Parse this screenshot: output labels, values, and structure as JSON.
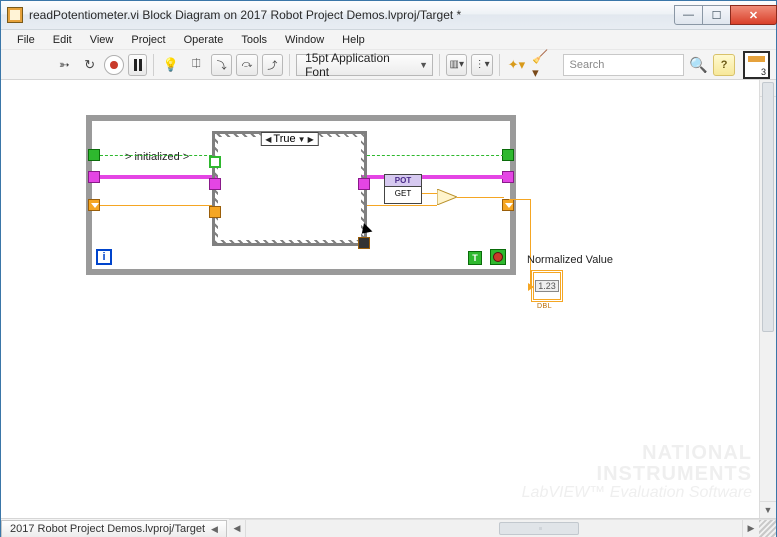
{
  "window": {
    "title": "readPotentiometer.vi Block Diagram on 2017 Robot Project Demos.lvproj/Target *"
  },
  "menu": {
    "file": "File",
    "edit": "Edit",
    "view": "View",
    "project": "Project",
    "operate": "Operate",
    "tools": "Tools",
    "window": "Window",
    "help": "Help"
  },
  "toolbar": {
    "font_label": "15pt Application Font",
    "search_placeholder": "Search",
    "help_label": "?",
    "context_badge": "3"
  },
  "diagram": {
    "case_selector": "True",
    "init_text": "> initialized >",
    "loop_index": "i",
    "bool_const": "T",
    "pot_header": "POT",
    "pot_sub": "GET",
    "indicator_label": "Normalized Value",
    "indicator_value": "1.23",
    "indicator_type": "DBL"
  },
  "status": {
    "tab": "2017 Robot Project Demos.lvproj/Target"
  },
  "watermark": {
    "l1": "NATIONAL",
    "l2": "INSTRUMENTS",
    "l3": "LabVIEW™ Evaluation Software"
  }
}
